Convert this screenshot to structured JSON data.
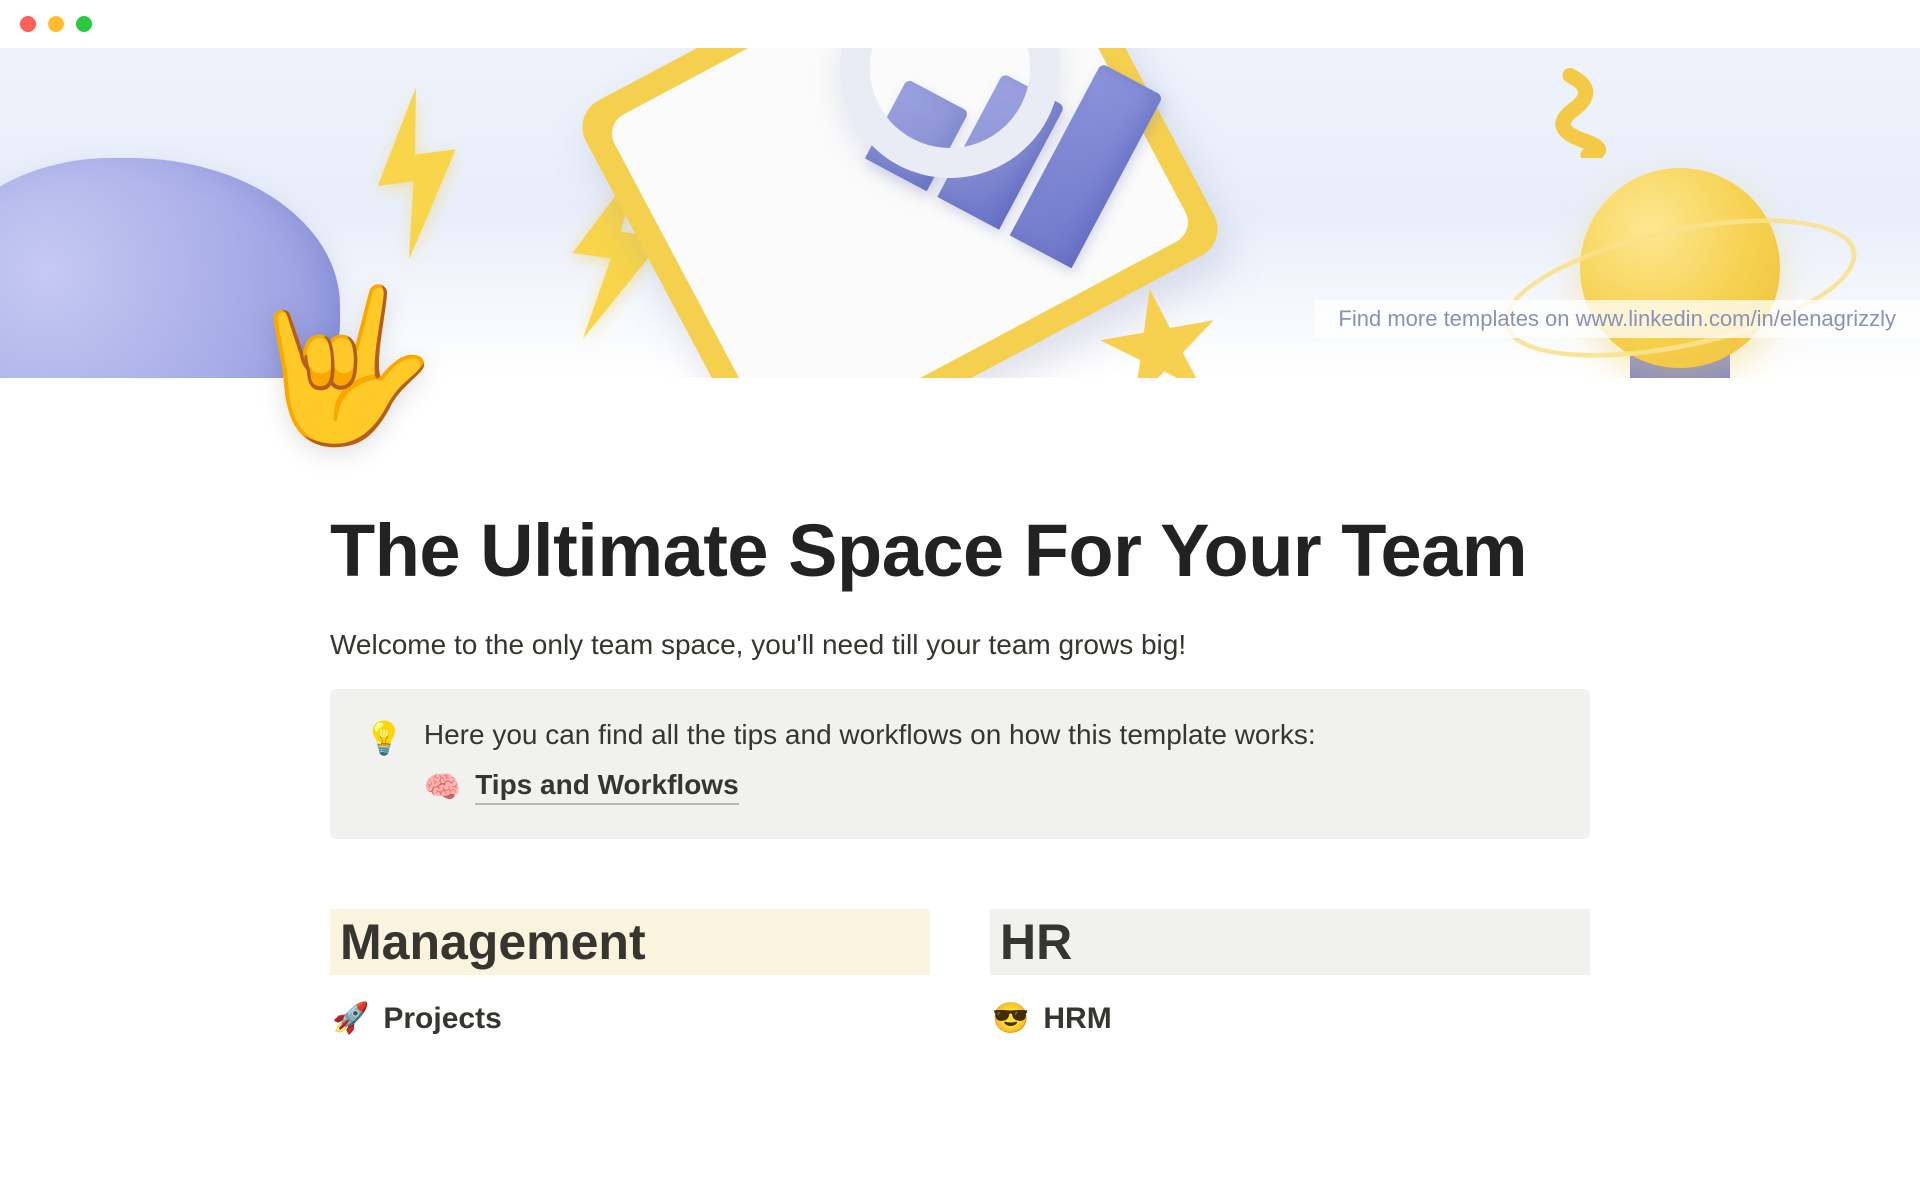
{
  "banner": {
    "linkText": "Find more templates on www.linkedin.com/in/elenagrizzly"
  },
  "page": {
    "emoji": "🤟",
    "title": "The Ultimate Space For Your Team",
    "subtitle": "Welcome to the only team space, you'll need till your team grows big!"
  },
  "callout": {
    "icon": "💡",
    "text": "Here you can find all the tips and workflows on how this template works:",
    "linkIcon": "🧠",
    "linkLabel": "Tips and Workflows"
  },
  "sections": {
    "management": {
      "heading": "Management",
      "items": [
        {
          "icon": "🚀",
          "label": "Projects"
        }
      ]
    },
    "hr": {
      "heading": "HR",
      "items": [
        {
          "icon": "😎",
          "label": "HRM"
        }
      ]
    }
  }
}
